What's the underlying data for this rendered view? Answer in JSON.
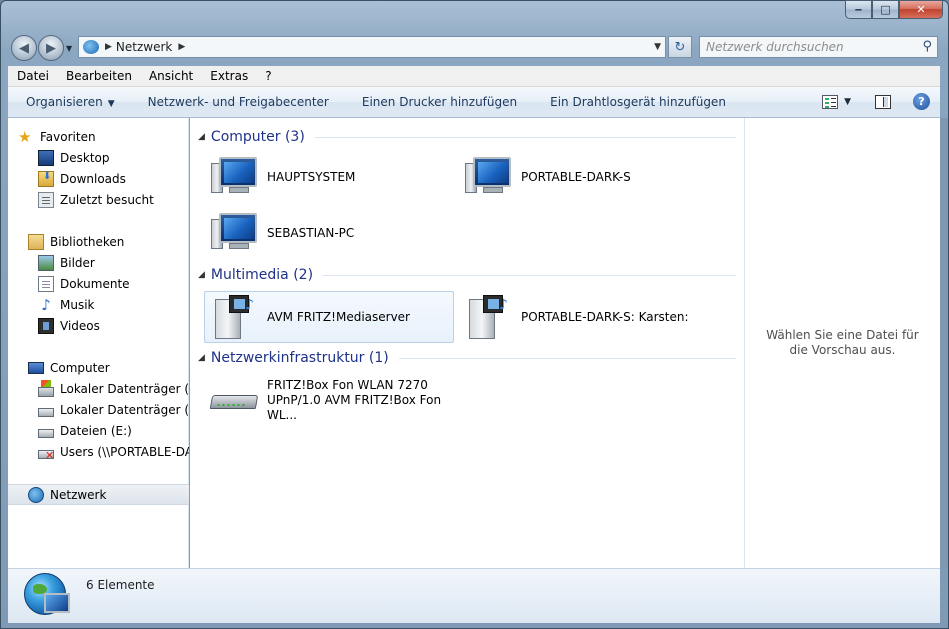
{
  "window": {
    "minimize_symbol": "‒",
    "maximize_symbol": "□",
    "close_symbol": "✕"
  },
  "address": {
    "crumb": "Netzwerk",
    "search_placeholder": "Netzwerk durchsuchen"
  },
  "menu": [
    "Datei",
    "Bearbeiten",
    "Ansicht",
    "Extras",
    "?"
  ],
  "commands": {
    "organize": "Organisieren",
    "network_center": "Netzwerk- und Freigabecenter",
    "add_printer": "Einen Drucker hinzufügen",
    "add_wireless": "Ein Drahtlosgerät hinzufügen",
    "help": "?"
  },
  "sidebar": {
    "favorites": {
      "header": "Favoriten",
      "items": [
        "Desktop",
        "Downloads",
        "Zuletzt besucht"
      ]
    },
    "libraries": {
      "header": "Bibliotheken",
      "items": [
        "Bilder",
        "Dokumente",
        "Musik",
        "Videos"
      ]
    },
    "computer": {
      "header": "Computer",
      "items": [
        "Lokaler Datenträger (C:)",
        "Lokaler Datenträger (D:)",
        "Dateien (E:)",
        "Users (\\\\PORTABLE-DARK-S)"
      ]
    },
    "network": "Netzwerk"
  },
  "groups": {
    "computer": {
      "title": "Computer (3)",
      "items": [
        "HAUPTSYSTEM",
        "PORTABLE-DARK-S",
        "SEBASTIAN-PC"
      ]
    },
    "multimedia": {
      "title": "Multimedia (2)",
      "items": [
        "AVM FRITZ!Mediaserver",
        "PORTABLE-DARK-S: Karsten:"
      ]
    },
    "infrastructure": {
      "title": "Netzwerkinfrastruktur (1)",
      "item_line1": "FRITZ!Box Fon WLAN 7270",
      "item_line2": "UPnP/1.0 AVM FRITZ!Box Fon WL..."
    }
  },
  "preview": {
    "message": "Wählen Sie eine Datei für die Vorschau aus."
  },
  "status": {
    "count": "6 Elemente"
  },
  "colors": {
    "group_header": "#1e3287",
    "command_text": "#1e395b",
    "accent": "#2b6cc9"
  }
}
